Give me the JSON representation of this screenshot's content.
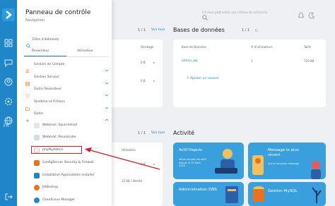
{
  "rail": {
    "lang": "FR"
  },
  "search": {
    "placeholder": "S'il vous plaît entrer vos critères de recherche"
  },
  "panel": {
    "title": "Panneau de contrôle",
    "subtitle": "Navigation",
    "filter": "Filtre d'éléments",
    "tabs": [
      "Revendeur",
      "Utilisateur"
    ],
    "menu": [
      {
        "label": "Gestion de Compte"
      },
      {
        "label": "Gestion Serveur"
      },
      {
        "label": "Outils Revendeur"
      },
      {
        "label": "Système et Fichiers"
      },
      {
        "label": "Outils"
      }
    ],
    "sub_items": [
      {
        "label": "Webmail: Squirrelmail"
      },
      {
        "label": "Webmail: Roundcube"
      },
      {
        "label": "phpMyAdmin"
      },
      {
        "label": "ConfigServer Security & Firewall"
      },
      {
        "label": "Installation Applications Installer"
      },
      {
        "label": "JetBackup"
      },
      {
        "label": "CloudLinux Manager"
      }
    ]
  },
  "main": {
    "pager_top": "1 / 1",
    "pager_top_link": "Voir tout",
    "table_header": "Stockage",
    "rows": [
      {
        "value": "0 B"
      },
      {
        "value": "0 B"
      }
    ],
    "databases": {
      "title": "Bases de données",
      "pager": "1 / 1",
      "pager_link": "Voir tout",
      "headers": [
        "Base de Données",
        "# d'utilisateurs",
        "Taille"
      ],
      "row": {
        "name": "admin_wp",
        "users": "1",
        "size": "720 KB"
      },
      "add_label": "Ajouter un nouvel"
    },
    "activity": {
      "title": "Activité",
      "pager": "1 / 1",
      "pager_link": "Voir tout"
    },
    "bottom_left": {
      "header": "Utilisation",
      "value": "0 B",
      "limit": "15 KB / Illimité"
    },
    "tiles": [
      {
        "title": "Actif Depuis",
        "desc": "Votre compte est actif depuis le 15 Mars 2020",
        "color": "#3aa0dd"
      },
      {
        "title": "Message le plus récent",
        "desc": "Aucun nouveau message",
        "color": "#3aa0dd"
      },
      {
        "title": "Administration DNS",
        "desc": "",
        "color": "#3aa0dd"
      },
      {
        "title": "Gestion MySQL",
        "desc": "",
        "color": "#3aa0dd"
      }
    ]
  },
  "colors": {
    "accent": "#1f86c9",
    "highlight": "#d31f26",
    "menu_icon": "#e8731c"
  }
}
